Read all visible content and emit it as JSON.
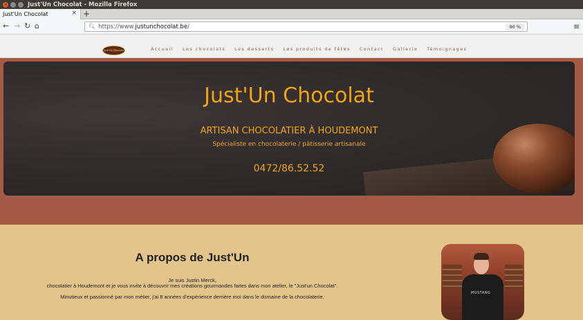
{
  "window": {
    "title": "Just'Un Chocolat - Mozilla Firefox"
  },
  "browser": {
    "tab_title": "Just'Un Chocolat",
    "tab_close": "×",
    "new_tab": "+",
    "url_prefix": "https://www.",
    "url_domain": "justunchocolat.be",
    "url_suffix": "/",
    "zoom": "90 %"
  },
  "site": {
    "logo_text": "Just'Un Chocolat",
    "nav": [
      "Accueil",
      "Les chocolats",
      "Les desserts",
      "Les produits de fêtes",
      "Contact",
      "Gallerie",
      "Témoignages"
    ],
    "hero": {
      "title": "Just'Un Chocolat",
      "subtitle": "ARTISAN CHOCOLATIER À HOUDEMONT",
      "tagline": "Spécialiste en chocolaterie / pâtisserie artisanale",
      "phone": "0472/86.52.52"
    },
    "about": {
      "title": "A propos de Just'Un",
      "line1": "Je suis Justin Merck,",
      "line2": "chocolatier à Houdemont et je vous invite à découvrir mes créations gourmandes faites dans mon atelier, le \"Just'un Chocolat\".",
      "line3": "Minutieux et passionné par mon métier, j'ai 8 années d'expérience derrière moi dans le domaine de la chocolaterie.",
      "shirt_text": "MUSTANG"
    }
  },
  "colors": {
    "accent": "#f2a413",
    "hero_band": "#a45a45",
    "about_bg": "#e3c48b",
    "nav_text": "#8a6040"
  }
}
